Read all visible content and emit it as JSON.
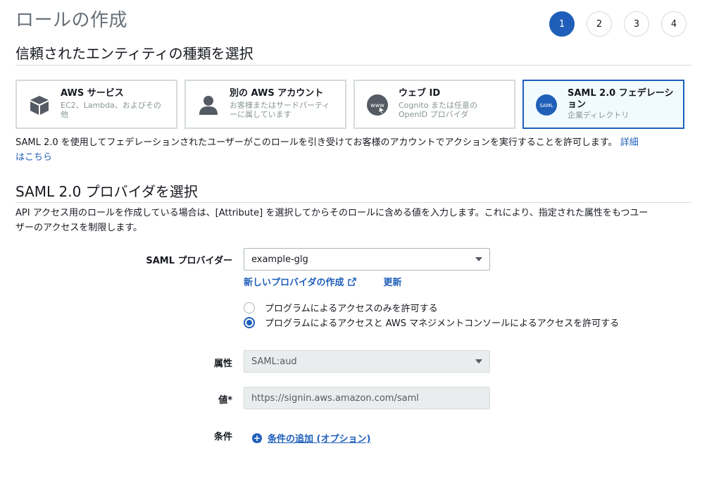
{
  "page": {
    "title": "ロールの作成"
  },
  "steps": [
    "1",
    "2",
    "3",
    "4"
  ],
  "entity_section": {
    "heading": "信頼されたエンティティの種類を選択"
  },
  "cards": [
    {
      "title": "AWS サービス",
      "sub1": "EC2、Lambda、およびその",
      "sub2": "他",
      "icon": "cube-icon"
    },
    {
      "title": "別の AWS アカウント",
      "sub1": "お客様またはサードパーティ",
      "sub2": "ーに属しています",
      "icon": "user-icon"
    },
    {
      "title": "ウェブ ID",
      "sub1": "Cognito または任意の",
      "sub2": "OpenID プロバイダ",
      "icon": "www-icon"
    },
    {
      "title1": "SAML 2.0 フェデレーシ",
      "title2": "ョン",
      "sub1": "企業ディレクトリ",
      "icon": "saml-icon",
      "icon_text": "SAML"
    }
  ],
  "entity_desc": {
    "text": "SAML 2.0 を使用してフェデレーションされたユーザーがこのロールを引き受けてお客様のアカウントでアクションを実行することを許可します。",
    "link1": "詳細",
    "link2": "はこちら"
  },
  "provider_section": {
    "heading": "SAML 2.0 プロバイダを選択",
    "desc1": "API アクセス用のロールを作成している場合は、[Attribute] を選択してからそのロールに含める値を入力します。これにより、指定された属性をもつユー",
    "desc2": "ザーのアクセスを制限します。"
  },
  "form": {
    "provider_label": "SAML プロバイダー",
    "provider_value": "example-glg",
    "new_provider_link": "新しいプロバイダの作成",
    "refresh_link": "更新",
    "radio_programmatic": "プログラムによるアクセスのみを許可する",
    "radio_console": "プログラムによるアクセスと AWS マネジメントコンソールによるアクセスを許可する",
    "attribute_label": "属性",
    "attribute_value": "SAML:aud",
    "value_label": "値*",
    "value_value": "https://signin.aws.amazon.com/saml",
    "condition_label": "条件",
    "add_condition": "条件の追加 (オプション)"
  },
  "colors": {
    "accent": "#1f5fb9",
    "selected_bg": "#f1faff",
    "border": "#d5dbdb",
    "muted": "#879596"
  }
}
